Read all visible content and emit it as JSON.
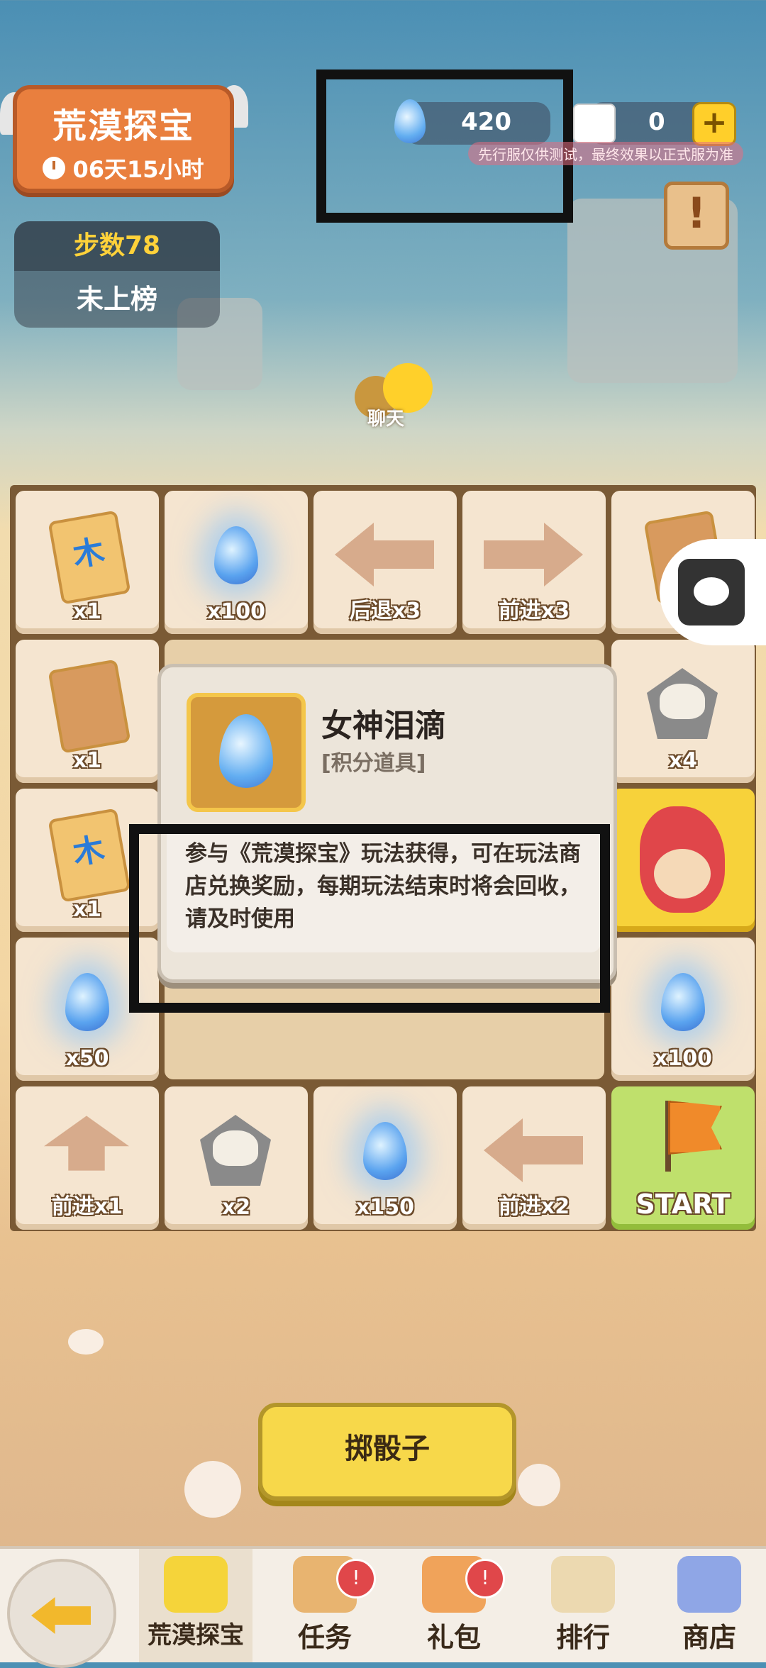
{
  "event": {
    "title": "荒漠探宝",
    "timer": "06天15小时"
  },
  "steps": {
    "label": "步数78",
    "rank": "未上榜"
  },
  "currency": {
    "tears": "420",
    "dice": "0",
    "plus": "+",
    "notice": "先行服仅供测试，最终效果以正式服为准"
  },
  "info_button": "!",
  "chat": {
    "label": "聊天"
  },
  "board": {
    "tiles": [
      {
        "label": "x1"
      },
      {
        "label": "x100"
      },
      {
        "label": "后退x3"
      },
      {
        "label": "前进x3"
      },
      {
        "label": ""
      },
      {
        "label": "x1"
      },
      {
        "label": "x4"
      },
      {
        "label": "x1"
      },
      {
        "label": ""
      },
      {
        "label": "x50"
      },
      {
        "label": "x100"
      },
      {
        "label": "前进x1"
      },
      {
        "label": "x2"
      },
      {
        "label": "x150"
      },
      {
        "label": "前进x2"
      },
      {
        "label": "START"
      }
    ]
  },
  "popup": {
    "name": "女神泪滴",
    "type": "[积分道具]",
    "description": "参与《荒漠探宝》玩法获得，可在玩法商店兑换奖励，每期玩法结束时将会回收，请及时使用"
  },
  "roll_button": "掷骰子",
  "bottom_nav": {
    "items": [
      {
        "label": "荒漠探宝"
      },
      {
        "label": "任务"
      },
      {
        "label": "礼包"
      },
      {
        "label": "排行"
      },
      {
        "label": "商店"
      }
    ],
    "badge": "!"
  },
  "colors": {
    "accent": "#f7d84a",
    "banner": "#e97f3e",
    "step_highlight": "#ffd23a"
  }
}
